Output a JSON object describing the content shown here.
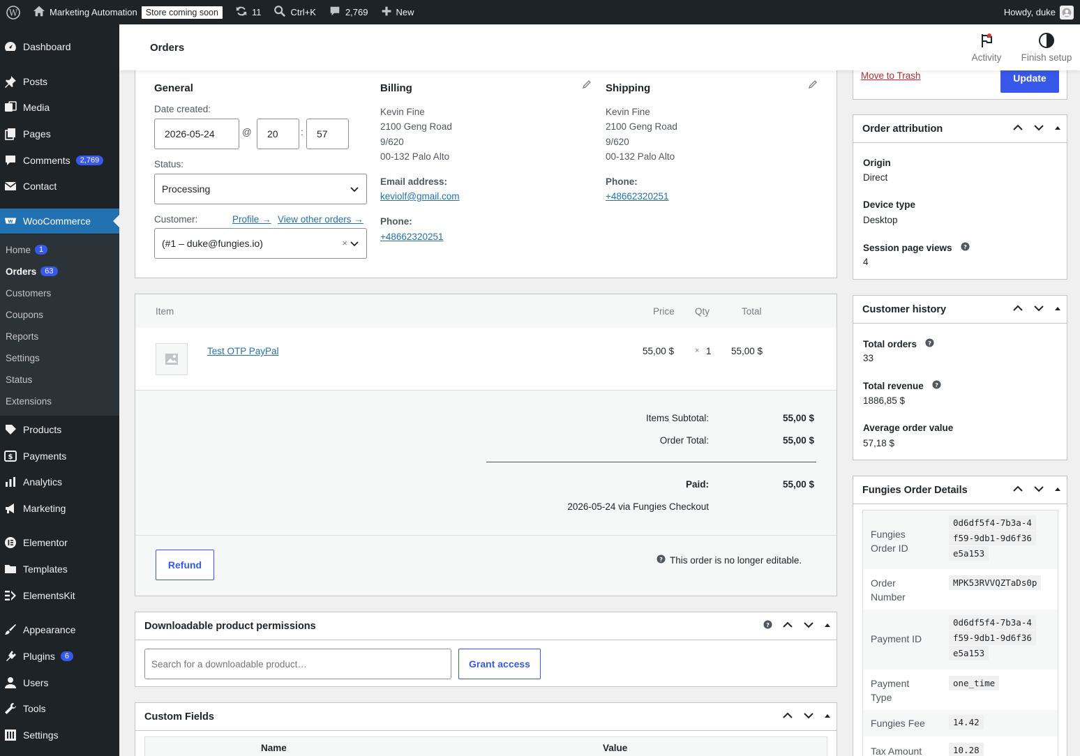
{
  "adminbar": {
    "site_name": "Marketing Automation",
    "store_badge": "Store coming soon",
    "updates_count": "11",
    "search_shortcut": "Ctrl+K",
    "comments_count": "2,769",
    "new_label": "New",
    "howdy": "Howdy, duke"
  },
  "sidebar": {
    "dashboard": "Dashboard",
    "posts": "Posts",
    "media": "Media",
    "pages": "Pages",
    "comments": "Comments",
    "comments_badge": "2,769",
    "contact": "Contact",
    "woocommerce": "WooCommerce",
    "submenu": {
      "home": "Home",
      "home_badge": "1",
      "orders": "Orders",
      "orders_badge": "63",
      "customers": "Customers",
      "coupons": "Coupons",
      "reports": "Reports",
      "settings": "Settings",
      "status": "Status",
      "extensions": "Extensions"
    },
    "products": "Products",
    "payments": "Payments",
    "analytics": "Analytics",
    "marketing": "Marketing",
    "elementor": "Elementor",
    "templates": "Templates",
    "elementskit": "ElementsKit",
    "appearance": "Appearance",
    "plugins": "Plugins",
    "plugins_badge": "6",
    "users": "Users",
    "tools": "Tools",
    "settings": "Settings"
  },
  "header": {
    "title": "Orders",
    "activity": "Activity",
    "finish_setup": "Finish setup"
  },
  "order": {
    "general_title": "General",
    "date_created_label": "Date created:",
    "date": "2026-05-24",
    "at": "@",
    "hour": "20",
    "colon": ":",
    "minute": "57",
    "status_label": "Status:",
    "status": "Processing",
    "customer_label": "Customer:",
    "profile_link": "Profile →",
    "view_orders_link": "View other orders →",
    "customer": "(#1 – duke@fungies.io)",
    "billing_title": "Billing",
    "billing_address": [
      "Kevin Fine",
      "2100 Geng Road",
      "9/620",
      "00-132 Palo Alto"
    ],
    "email_label": "Email address:",
    "email": "keviolf@gmail.com",
    "phone_label": "Phone:",
    "billing_phone": "+48662320251",
    "shipping_title": "Shipping",
    "shipping_address": [
      "Kevin Fine",
      "2100 Geng Road",
      "9/620",
      "00-132 Palo Alto"
    ],
    "shipping_phone": "+48662320251"
  },
  "items": {
    "col_item": "Item",
    "col_price": "Price",
    "col_qty": "Qty",
    "col_total": "Total",
    "product_name": "Test OTP PayPal",
    "price": "55,00 $",
    "qty_x": "×",
    "qty": "1",
    "total": "55,00 $",
    "subtotal_label": "Items Subtotal:",
    "subtotal": "55,00 $",
    "order_total_label": "Order Total:",
    "order_total": "55,00 $",
    "paid_label": "Paid:",
    "paid": "55,00 $",
    "paid_note": "2026-05-24 via Fungies Checkout",
    "refund": "Refund",
    "not_editable": "This order is no longer editable."
  },
  "downloads": {
    "title": "Downloadable product permissions",
    "search_placeholder": "Search for a downloadable product…",
    "grant": "Grant access"
  },
  "custom_fields": {
    "title": "Custom Fields",
    "col_name": "Name",
    "col_value": "Value"
  },
  "actions": {
    "trash": "Move to Trash",
    "update": "Update"
  },
  "attribution": {
    "title": "Order attribution",
    "origin_label": "Origin",
    "origin": "Direct",
    "device_label": "Device type",
    "device": "Desktop",
    "views_label": "Session page views",
    "views": "4"
  },
  "history": {
    "title": "Customer history",
    "orders_label": "Total orders",
    "orders": "33",
    "revenue_label": "Total revenue",
    "revenue": "1886,85 $",
    "aov_label": "Average order value",
    "aov": "57,18 $"
  },
  "fungies": {
    "title": "Fungies Order Details",
    "rows": [
      {
        "label": "Fungies Order ID",
        "value": "0d6df5f4-7b3a-4f59-9db1-9d6f36e5a153"
      },
      {
        "label": "Order Number",
        "value": "MPK53RVVQZTaDs0p"
      },
      {
        "label": "Payment ID",
        "value": "0d6df5f4-7b3a-4f59-9db1-9d6f36e5a153"
      },
      {
        "label": "Payment Type",
        "value": "one_time"
      },
      {
        "label": "Fungies Fee",
        "value": "14.42"
      },
      {
        "label": "Tax Amount",
        "value": "10.28"
      }
    ]
  }
}
